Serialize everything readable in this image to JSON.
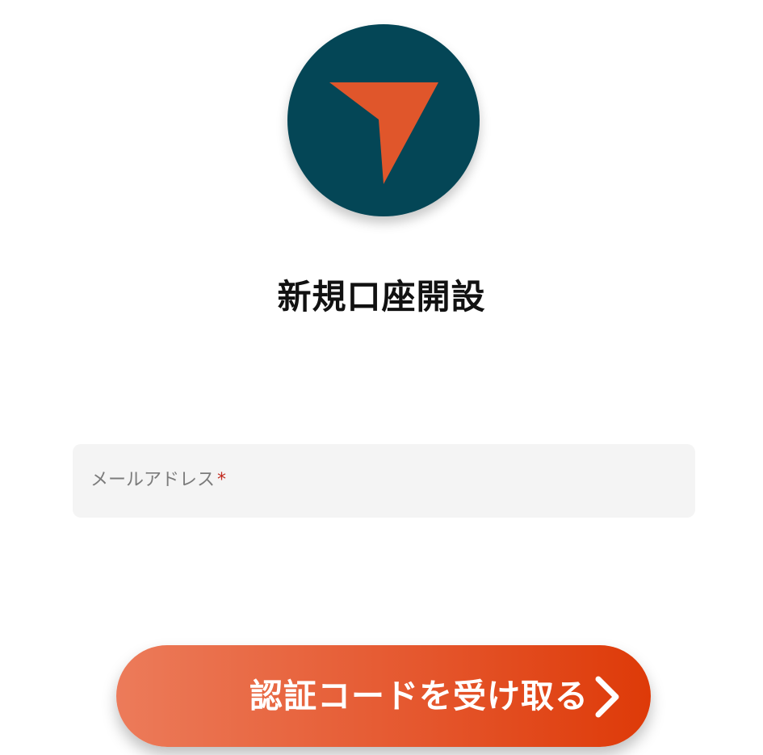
{
  "brand": {
    "logo_icon": "paper-plane-arrow-icon",
    "circle_color": "#044656",
    "arrow_color": "#e0562b"
  },
  "page": {
    "title": "新規口座開設"
  },
  "form": {
    "email_label": "メールアドレス",
    "required_mark": "*"
  },
  "actions": {
    "submit_label": "認証コードを受け取る",
    "submit_icon": "chevron-right-icon"
  }
}
